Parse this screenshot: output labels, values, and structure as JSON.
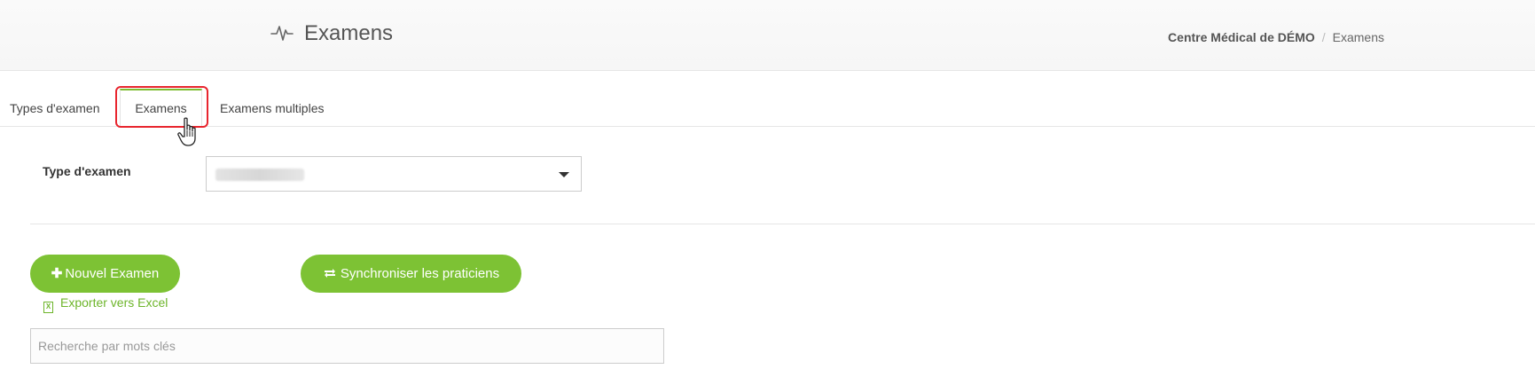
{
  "header": {
    "title": "Examens",
    "title_icon": "activity-pulse-icon",
    "breadcrumb": {
      "center": "Centre Médical de DÉMO",
      "separator": "/",
      "current": "Examens"
    }
  },
  "tabs": [
    {
      "label": "Types d'examen",
      "active": false
    },
    {
      "label": "Examens",
      "active": true
    },
    {
      "label": "Examens multiples",
      "active": false
    }
  ],
  "filter": {
    "label": "Type d'examen",
    "selected_value": ""
  },
  "actions": {
    "new_exam_label": "Nouvel Examen",
    "sync_label": "Synchroniser les praticiens",
    "export_label": "Exporter vers Excel"
  },
  "search": {
    "placeholder": "Recherche par mots clés",
    "value": ""
  },
  "colors": {
    "accent": "#7dc234",
    "highlight": "#e8252e"
  }
}
